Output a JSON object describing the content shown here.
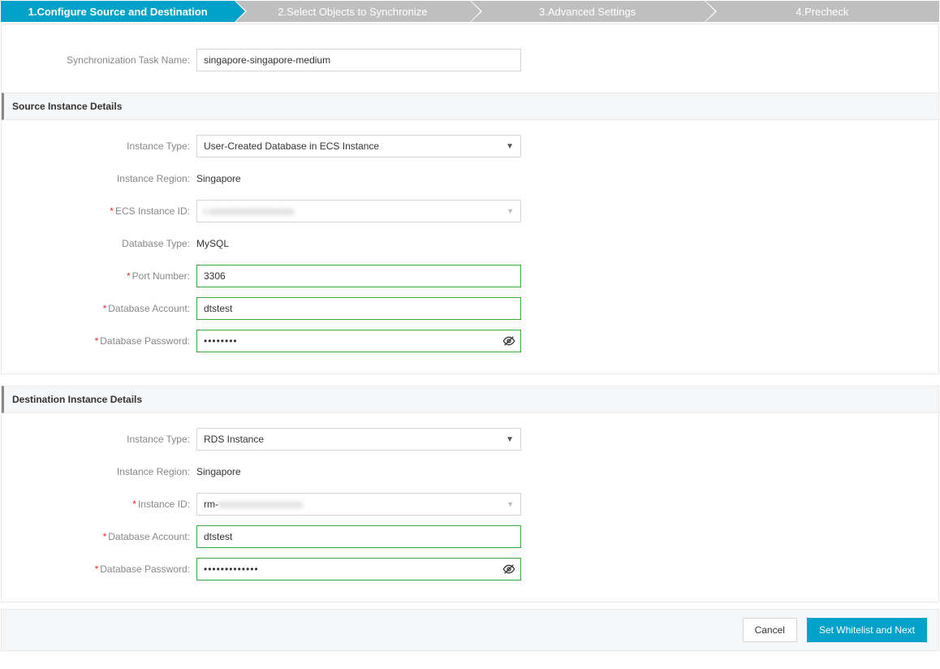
{
  "steps": [
    "1.Configure Source and Destination",
    "2.Select Objects to Synchronize",
    "3.Advanced Settings",
    "4.Precheck"
  ],
  "task_name": {
    "label": "Synchronization Task Name:",
    "value": "singapore-singapore-medium"
  },
  "source": {
    "header": "Source Instance Details",
    "instance_type": {
      "label": "Instance Type:",
      "value": "User-Created Database in ECS Instance"
    },
    "instance_region": {
      "label": "Instance Region:",
      "value": "Singapore"
    },
    "ecs_instance_id": {
      "label": "ECS Instance ID:",
      "value": "i-xxxxxxxxxxxxxxxx"
    },
    "database_type": {
      "label": "Database Type:",
      "value": "MySQL"
    },
    "port_number": {
      "label": "Port Number:",
      "value": "3306"
    },
    "database_account": {
      "label": "Database Account:",
      "value": "dtstest"
    },
    "database_password": {
      "label": "Database Password:",
      "value": "••••••••"
    }
  },
  "destination": {
    "header": "Destination Instance Details",
    "instance_type": {
      "label": "Instance Type:",
      "value": "RDS Instance"
    },
    "instance_region": {
      "label": "Instance Region:",
      "value": "Singapore"
    },
    "instance_id": {
      "label": "Instance ID:",
      "value_prefix": "rm-",
      "value_blur": "xxxxxxxxxxxxxxxx"
    },
    "database_account": {
      "label": "Database Account:",
      "value": "dtstest"
    },
    "database_password": {
      "label": "Database Password:",
      "value": "•••••••••••••"
    }
  },
  "footer": {
    "cancel": "Cancel",
    "next": "Set Whitelist and Next"
  }
}
